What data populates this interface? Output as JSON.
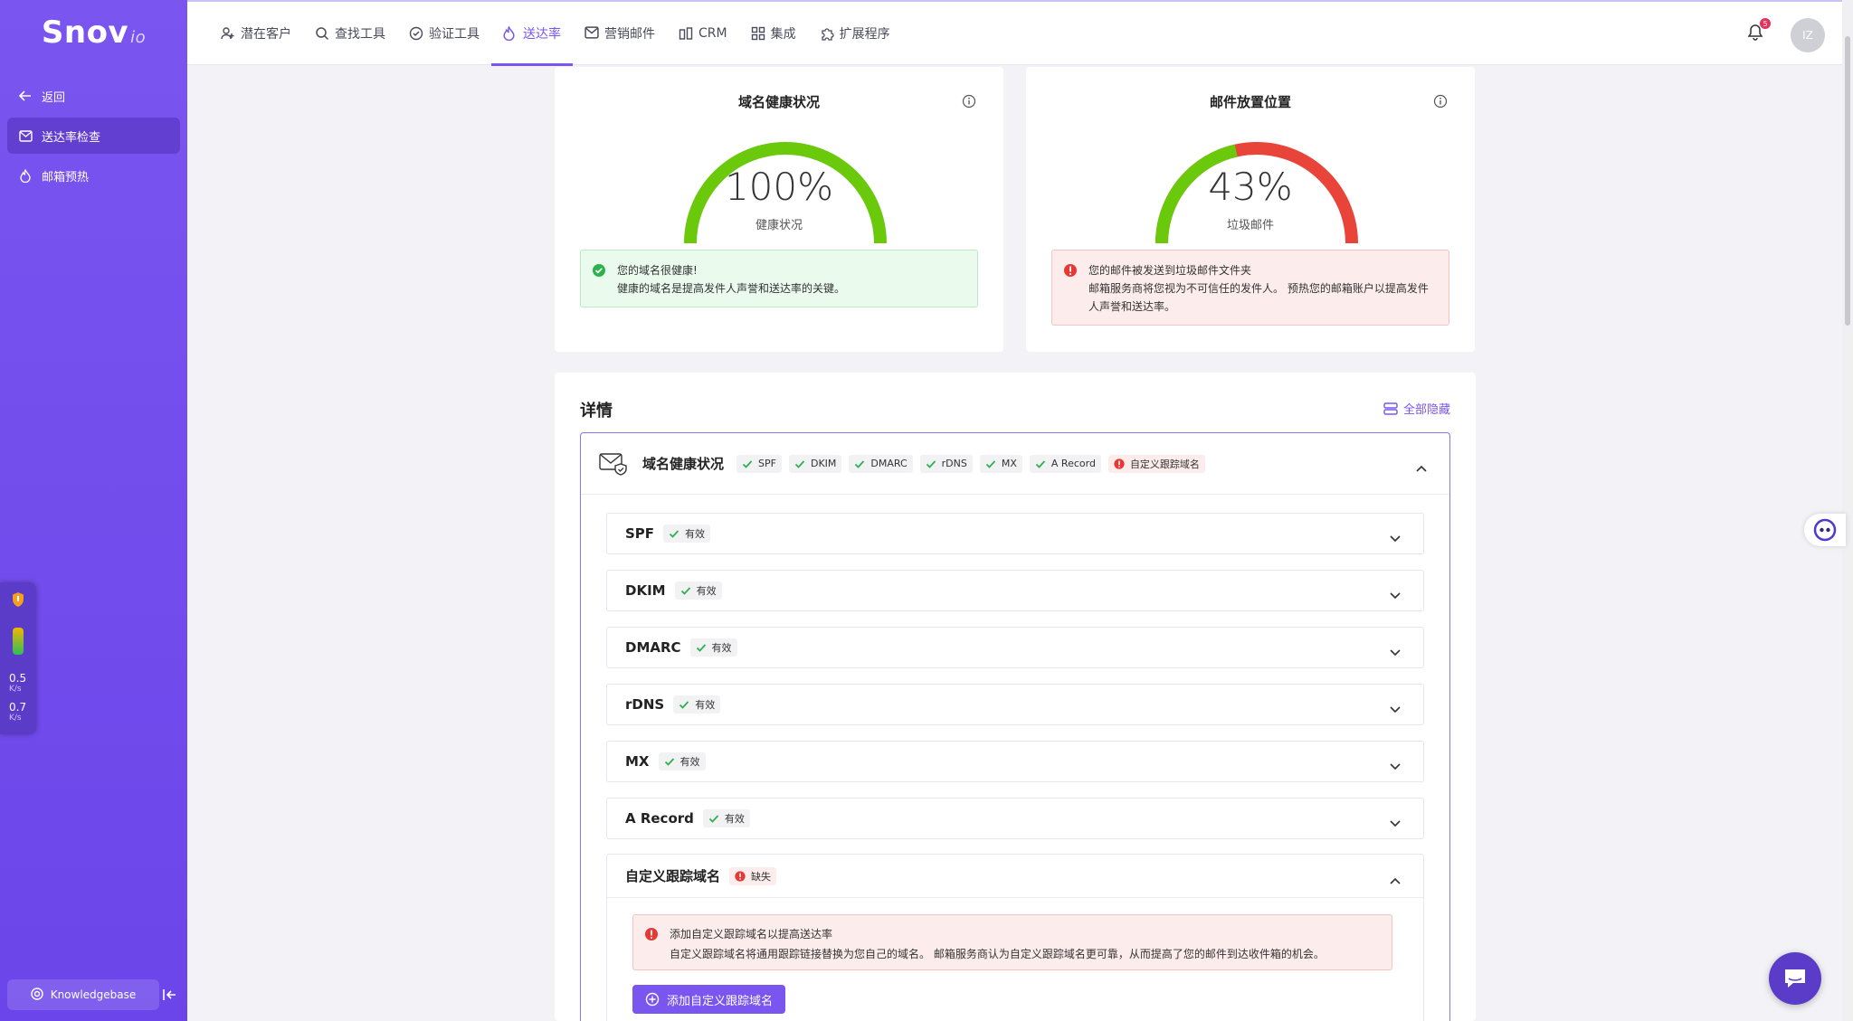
{
  "app": {
    "logo": "Snov",
    "logo_suffix": "io"
  },
  "sidebar": {
    "back_label": "返回",
    "items": [
      {
        "label": "送达率检查",
        "icon": "mail-icon",
        "active": true
      },
      {
        "label": "邮箱预热",
        "icon": "flame-icon",
        "active": false
      }
    ],
    "knowledgebase_label": "Knowledgebase"
  },
  "widget": {
    "speed_up": "0.5",
    "speed_down": "0.7",
    "unit": "K/s"
  },
  "topnav": {
    "items": [
      {
        "label": "潜在客户",
        "icon": "users-icon"
      },
      {
        "label": "查找工具",
        "icon": "search-icon"
      },
      {
        "label": "验证工具",
        "icon": "check-circle-icon"
      },
      {
        "label": "送达率",
        "icon": "flame-icon",
        "active": true
      },
      {
        "label": "营销邮件",
        "icon": "mail-icon"
      },
      {
        "label": "CRM",
        "icon": "crm-icon"
      },
      {
        "label": "集成",
        "icon": "grid-icon"
      },
      {
        "label": "扩展程序",
        "icon": "puzzle-icon"
      }
    ],
    "notification_count": "5",
    "avatar_initials": "IZ"
  },
  "cards": {
    "domain_health": {
      "title": "域名健康状况",
      "value": "100%",
      "value_fraction": 1.0,
      "subtitle": "健康状况",
      "alert_title": "您的域名很健康!",
      "alert_text": "健康的域名是提高发件人声誉和送达率的关键。"
    },
    "placement": {
      "title": "邮件放置位置",
      "value": "43%",
      "value_fraction": 0.43,
      "subtitle": "垃圾邮件",
      "alert_title": "您的邮件被发送到垃圾邮件文件夹",
      "alert_text_1": "邮箱服务商将您视为不可信任的发件人。 预热您的邮箱账户以提高发件",
      "alert_text_2": "人声誉和送达率。"
    }
  },
  "details": {
    "title": "详情",
    "hide_all_label": "全部隐藏",
    "panel_title": "域名健康状况",
    "tags": [
      {
        "label": "SPF",
        "ok": true
      },
      {
        "label": "DKIM",
        "ok": true
      },
      {
        "label": "DMARC",
        "ok": true
      },
      {
        "label": "rDNS",
        "ok": true
      },
      {
        "label": "MX",
        "ok": true
      },
      {
        "label": "A Record",
        "ok": true
      },
      {
        "label": "自定义跟踪域名",
        "ok": false
      }
    ],
    "rows": [
      {
        "title": "SPF",
        "status": "有效"
      },
      {
        "title": "DKIM",
        "status": "有效"
      },
      {
        "title": "DMARC",
        "status": "有效"
      },
      {
        "title": "rDNS",
        "status": "有效"
      },
      {
        "title": "MX",
        "status": "有效"
      },
      {
        "title": "A Record",
        "status": "有效"
      }
    ],
    "tracking": {
      "title": "自定义跟踪域名",
      "status": "缺失",
      "alert_title": "添加自定义跟踪域名以提高送达率",
      "alert_text": "自定义跟踪域名将通用跟踪链接替换为您自己的域名。 邮箱服务商认为自定义跟踪域名更可靠，从而提高了您的邮件到达收件箱的机会。",
      "button_label": "添加自定义跟踪域名"
    }
  },
  "colors": {
    "accent": "#7a55ef",
    "ok": "#6ac90a",
    "bad": "#e8443a"
  }
}
